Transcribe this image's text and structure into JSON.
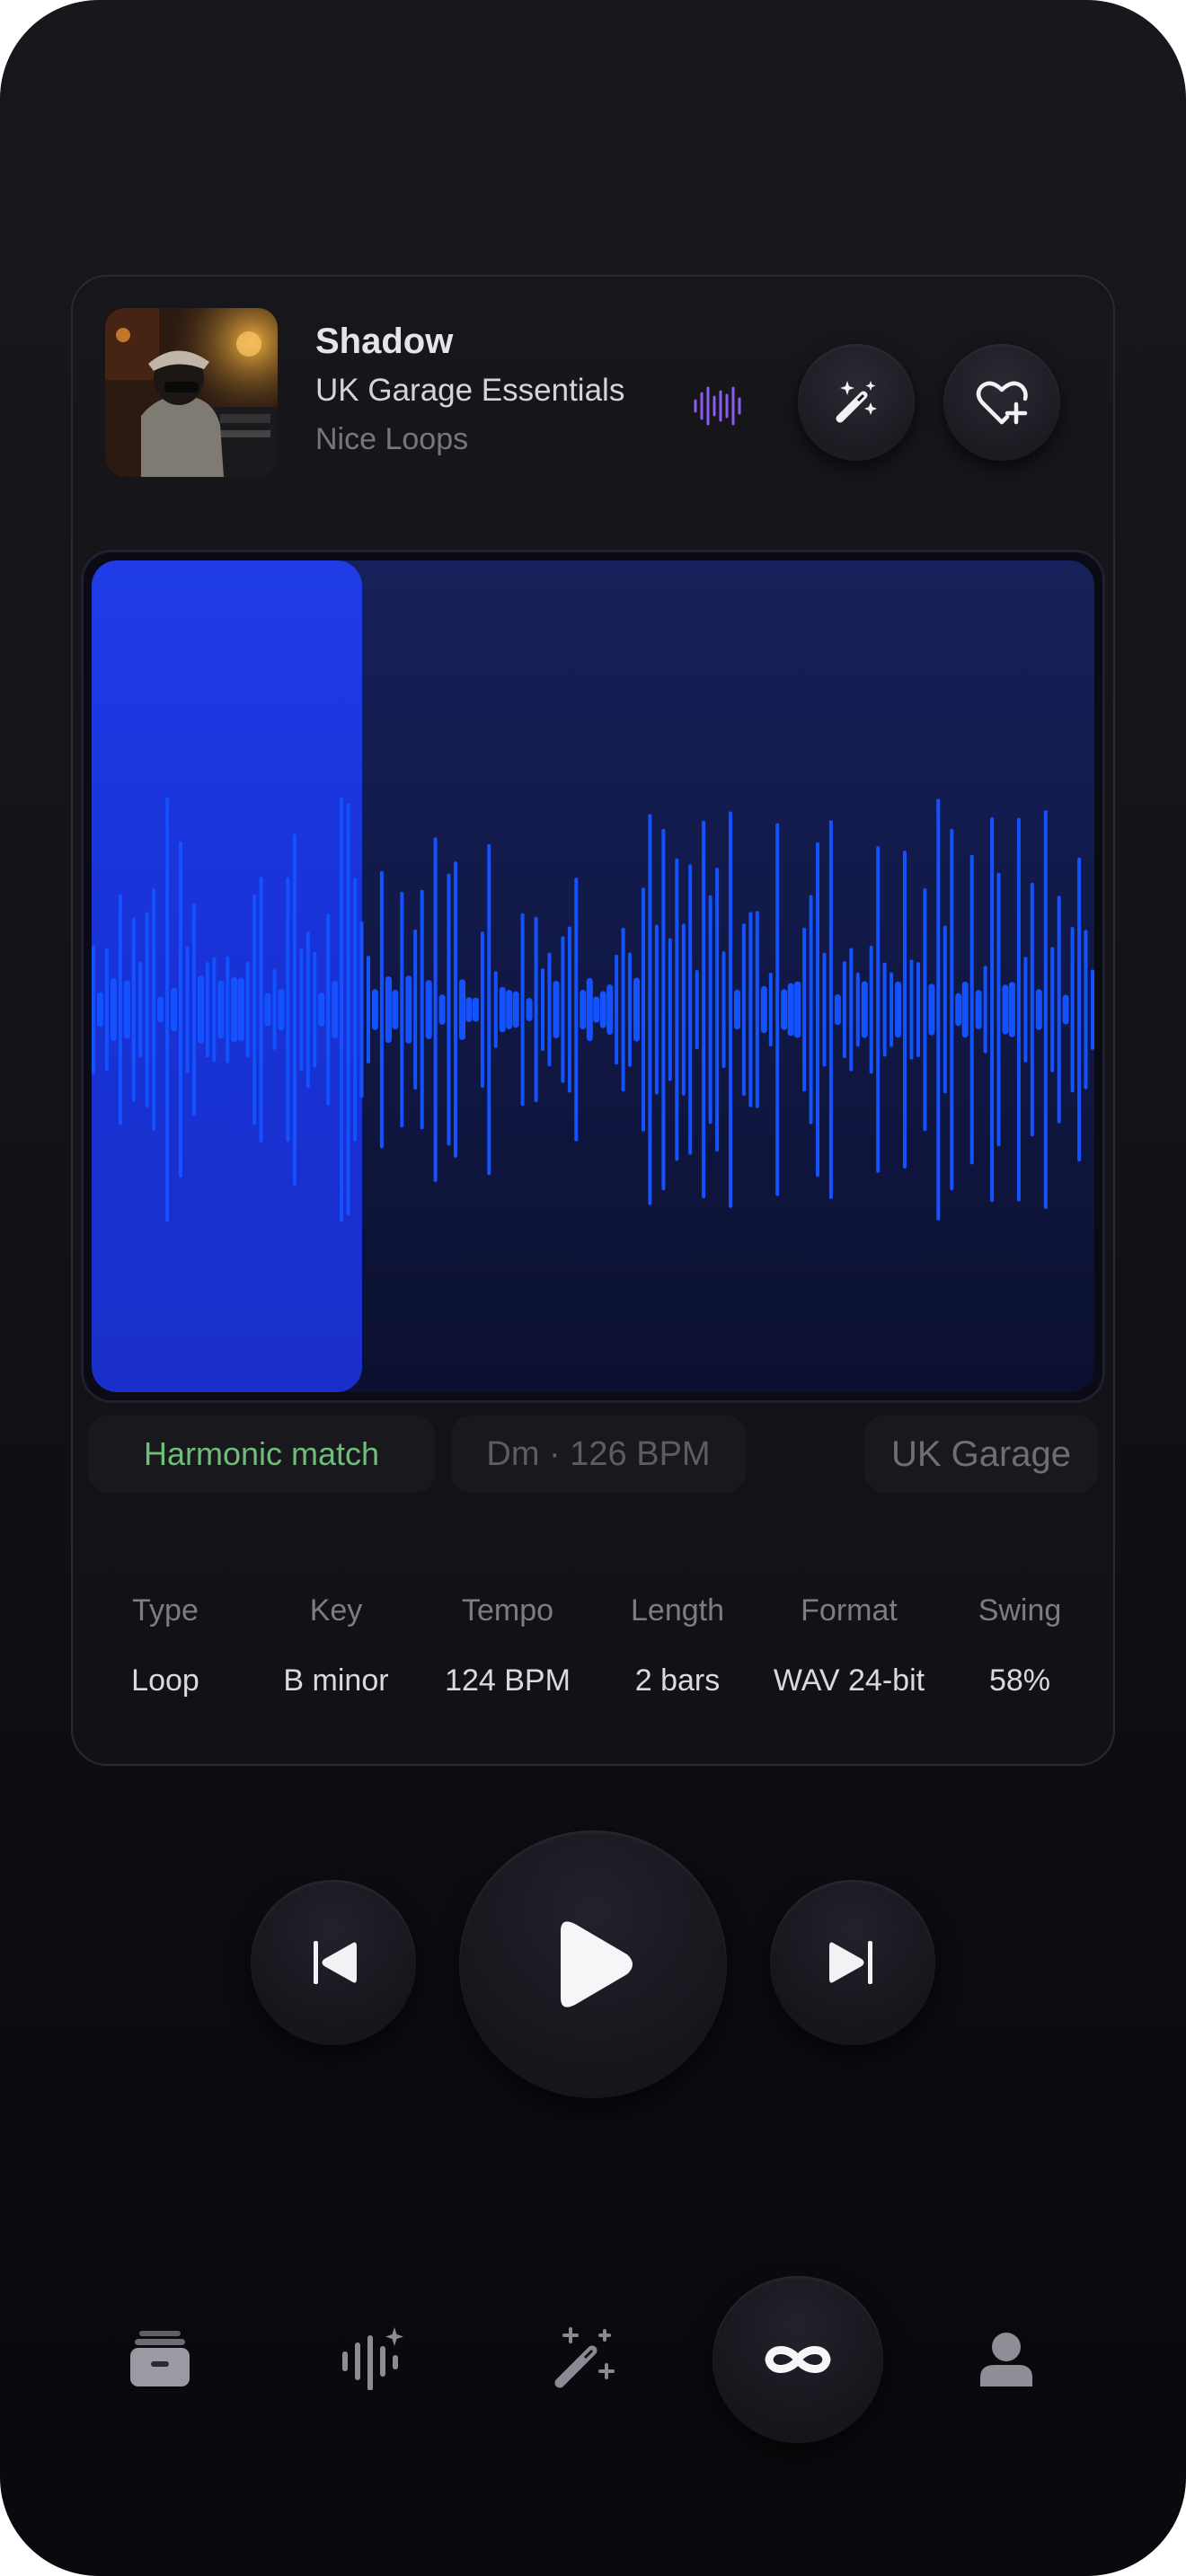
{
  "track": {
    "title": "Shadow",
    "pack": "UK Garage Essentials",
    "artist": "Nice Loops",
    "artwork_icon": "album-artwork"
  },
  "actions": [
    {
      "name": "magic-wand",
      "icon": "magic-wand-icon"
    },
    {
      "name": "favorite",
      "icon": "heart-plus-icon"
    }
  ],
  "waveform": {
    "progress": 0.27,
    "played_color": "#1a34d6",
    "wave_color": "#1452ff"
  },
  "tags": {
    "match": "Harmonic match",
    "key_tempo": "Dm · 126 BPM",
    "genre": "UK Garage"
  },
  "details": [
    {
      "label": "Type",
      "value": "Loop"
    },
    {
      "label": "Key",
      "value": "B minor"
    },
    {
      "label": "Tempo",
      "value": "124 BPM"
    },
    {
      "label": "Length",
      "value": "2 bars"
    },
    {
      "label": "Format",
      "value": "WAV 24-bit"
    },
    {
      "label": "Swing",
      "value": "58%"
    }
  ],
  "controls": [
    "skip-back-icon",
    "play-icon",
    "skip-forward-icon"
  ],
  "nav": [
    {
      "name": "library",
      "icon": "library-icon"
    },
    {
      "name": "sounds",
      "icon": "waveform-sparkle-icon"
    },
    {
      "name": "generate",
      "icon": "magic-wand-icon"
    },
    {
      "name": "loop",
      "icon": "infinity-icon",
      "active": true
    },
    {
      "name": "profile",
      "icon": "user-icon"
    }
  ],
  "colors": {
    "accent_blue": "#1452ff",
    "match_green": "#6fbd7a",
    "wave_icon_purple": "#8a5cf0"
  }
}
